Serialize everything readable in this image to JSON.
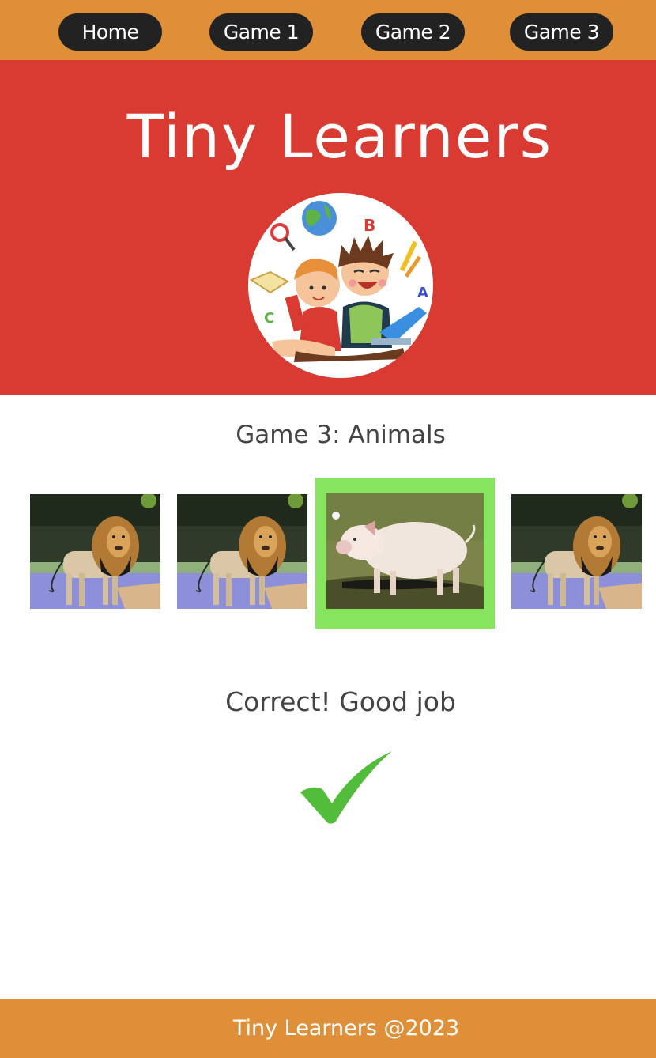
{
  "nav": {
    "items": [
      {
        "label": "Home"
      },
      {
        "label": "Game 1"
      },
      {
        "label": "Game 2"
      },
      {
        "label": "Game 3"
      }
    ]
  },
  "hero": {
    "title": "Tiny Learners",
    "logo": {
      "letters": [
        "B",
        "A",
        "C"
      ]
    }
  },
  "game": {
    "title": "Game 3: Animals",
    "options": [
      {
        "animal": "lion",
        "selected": false
      },
      {
        "animal": "lion",
        "selected": false
      },
      {
        "animal": "pig",
        "selected": true
      },
      {
        "animal": "lion",
        "selected": false
      }
    ],
    "feedback": "Correct! Good job",
    "result_icon": "checkmark-icon"
  },
  "footer": {
    "text": "Tiny Learners @2023"
  },
  "colors": {
    "nav_bg": "#e08f39",
    "hero_bg": "#d93a31",
    "button_bg": "#222222",
    "selected_border": "#86e45e",
    "check": "#52bd3a"
  }
}
